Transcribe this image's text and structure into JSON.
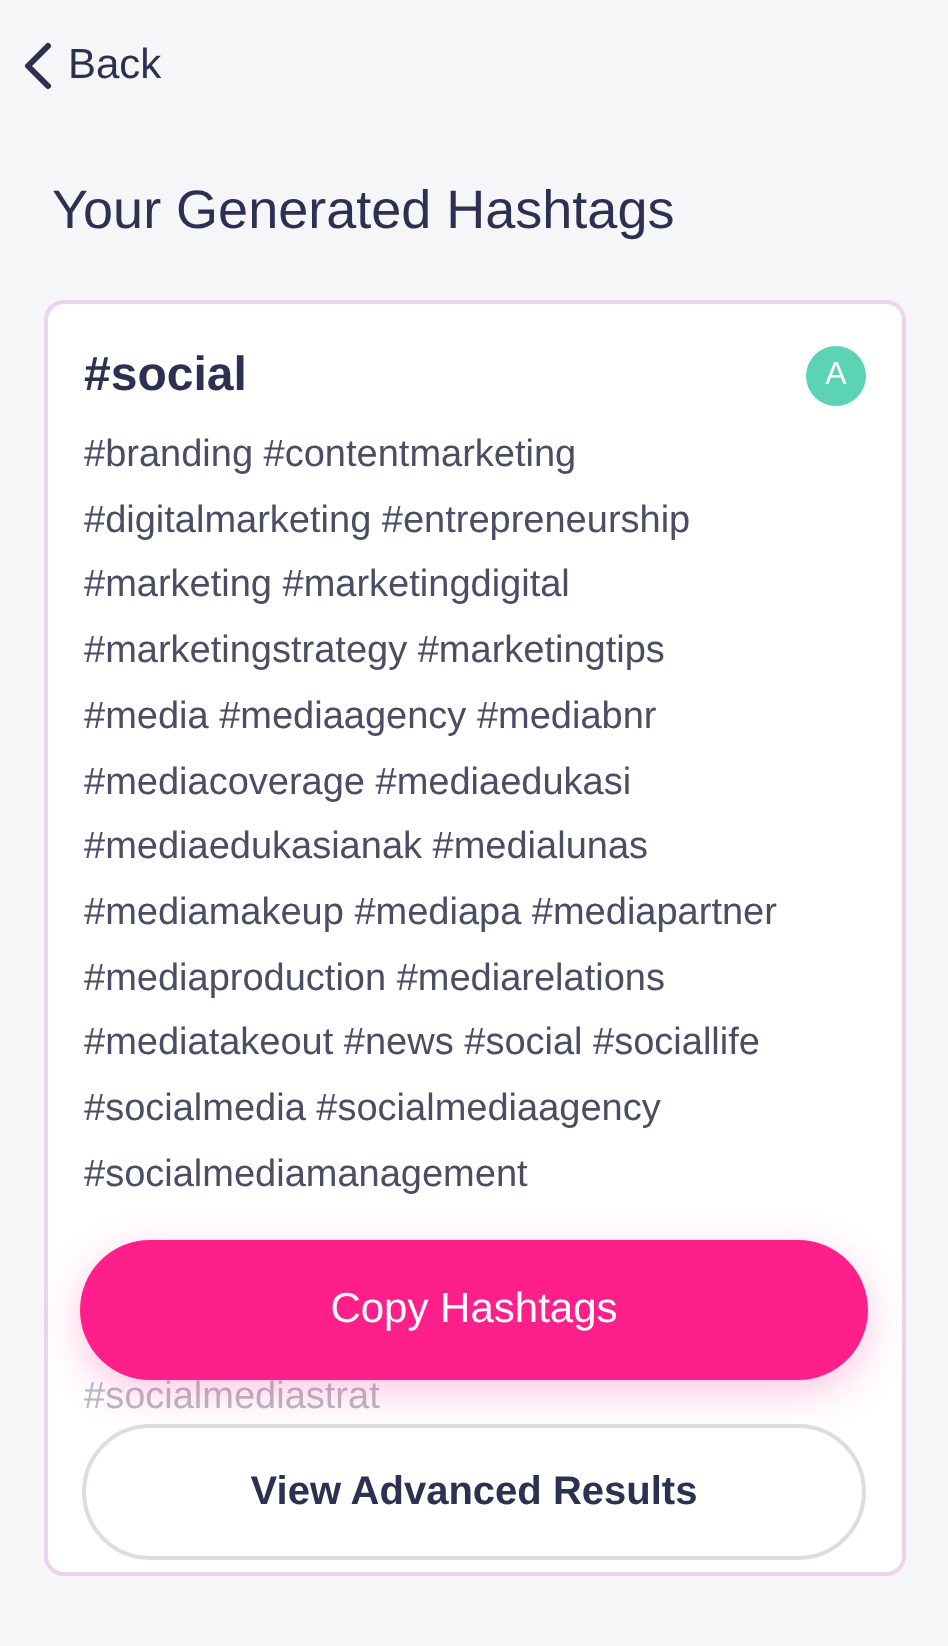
{
  "nav": {
    "back_label": "Back"
  },
  "title": "Your Generated Hashtags",
  "card": {
    "heading": "#social",
    "avatar": "A",
    "lines": [
      "#branding #contentmarketing",
      "#digitalmarketing #entrepreneurship",
      "#marketing #marketingdigital",
      "#marketingstrategy #marketingtips",
      "#media #mediaagency #mediabnr",
      "#mediacoverage #mediaedukasi",
      "#mediaedukasianak #medialunas",
      "#mediamakeup #mediapa #mediapartner",
      "#mediaproduction #mediarelations",
      "#mediatakeout #news #social #sociallife",
      "#socialmedia #socialmediaagency",
      "#socialmediamanagement"
    ],
    "faded_line": "#socialmediastrat"
  },
  "buttons": [
    {
      "kind": "primary",
      "label": "Copy Hashtags"
    },
    {
      "kind": "secondary",
      "label": "View Advanced Results"
    }
  ]
}
